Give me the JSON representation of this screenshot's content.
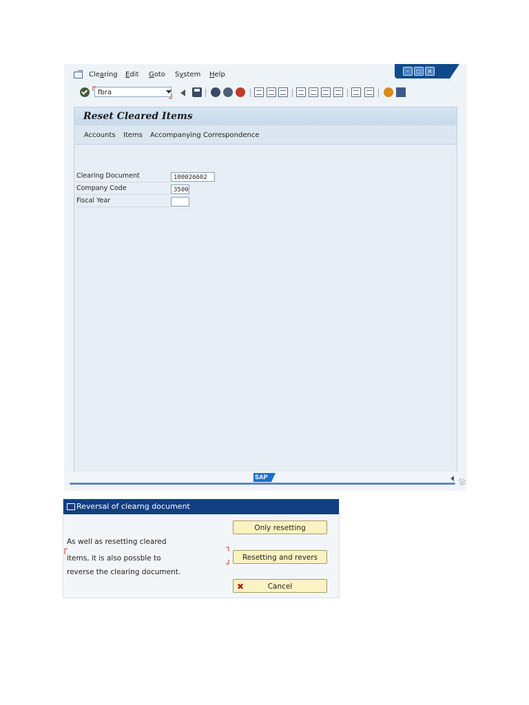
{
  "menubar": {
    "items": [
      {
        "pre": "Cle",
        "u": "a",
        "post": "ring"
      },
      {
        "pre": "",
        "u": "E",
        "post": "dit"
      },
      {
        "pre": "",
        "u": "G",
        "post": "oto"
      },
      {
        "pre": "S",
        "u": "y",
        "post": "stem"
      },
      {
        "pre": "",
        "u": "H",
        "post": "elp"
      }
    ]
  },
  "toolbar": {
    "command_value": "fbra"
  },
  "main": {
    "title": "Reset Cleared Items",
    "app_buttons": [
      "Accounts",
      "Items",
      "Accompanying Correspondence"
    ],
    "fields": [
      {
        "label": "Clearing Document",
        "value": "100026602"
      },
      {
        "label": "Company Code",
        "value": "3500"
      },
      {
        "label": "Fiscal Year",
        "value": ""
      }
    ]
  },
  "status": {
    "logo": "SAP"
  },
  "dialog": {
    "title": "Reversal of clearng document",
    "message": [
      "As well as resetting cleared",
      "items, it is also possble to",
      "reverse the clearing document."
    ],
    "buttons": {
      "only_resetting": "Only resetting",
      "resetting_and_reverse": "Resetting and revers",
      "cancel": "Cancel"
    }
  },
  "colors": {
    "dialog_header": "#113f82",
    "button_fill": "#fbf3c2",
    "workarea": "#e7eef5",
    "title_bar": "#c6d9ea"
  }
}
